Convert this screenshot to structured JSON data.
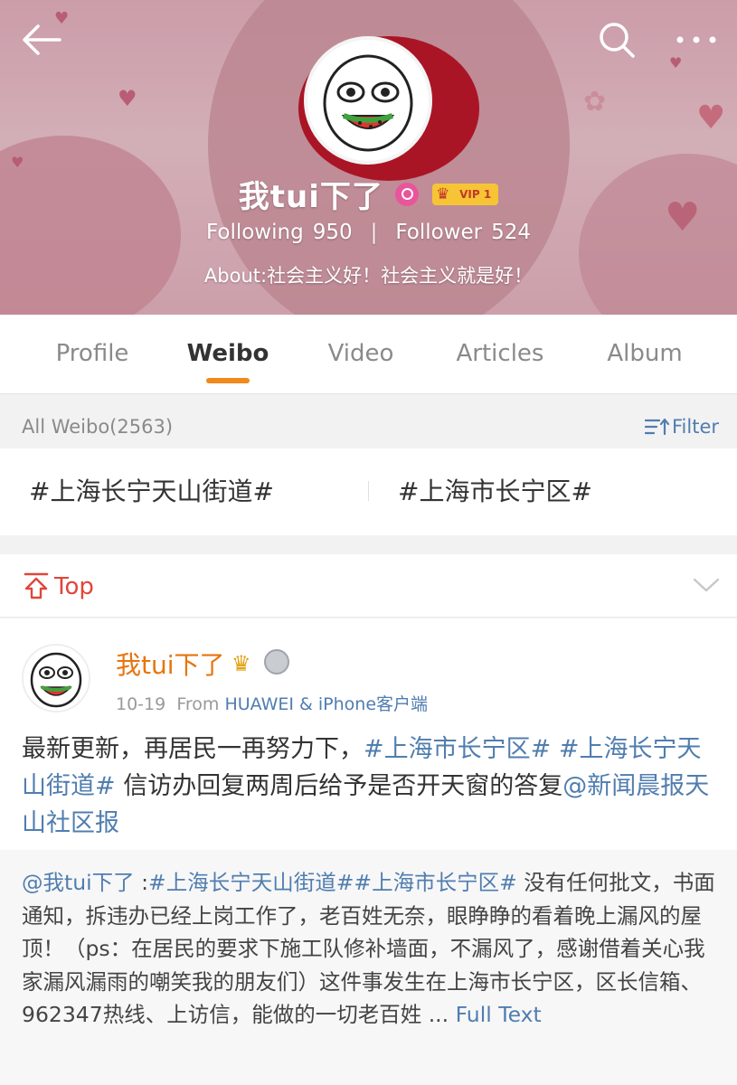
{
  "profile": {
    "name": "我tui下了",
    "vip_label": "VIP 1",
    "following_label": "Following",
    "following_count": "950",
    "follower_label": "Follower",
    "follower_count": "524",
    "separator": "|",
    "about": "About:社会主义好！社会主义就是好！"
  },
  "tabs": [
    {
      "label": "Profile"
    },
    {
      "label": "Weibo",
      "active": true
    },
    {
      "label": "Video"
    },
    {
      "label": "Articles"
    },
    {
      "label": "Album"
    }
  ],
  "feed_bar": {
    "all_label": "All Weibo(2563)",
    "filter_label": "Filter"
  },
  "topics": [
    "#上海长宁天山街道#",
    "#上海市长宁区#"
  ],
  "top_section": {
    "label": "Top"
  },
  "post": {
    "author": "我tui下了",
    "date": "10-19",
    "from_label": "From",
    "source": "HUAWEI & iPhone客户端",
    "text_1": "最新更新，再居民一再努力下，",
    "tag_1": "#上海市长宁区#",
    "tag_2": "#上海长宁天山街道#",
    "text_2": " 信访办回复两周后给予是否开天窗的答复",
    "mention": "@新闻晨报天山社区报",
    "repost": {
      "author_mention": "@我tui下了",
      "colon": " :",
      "tags": "#上海长宁天山街道##上海市长宁区#",
      "text": " 没有任何批文，书面通知，拆违办已经上岗工作了，老百姓无奈，眼睁睁的看着晚上漏风的屋顶！（ps：在居民的要求下施工队修补墙面，不漏风了，感谢借着关心我家漏风漏雨的嘲笑我的朋友们）这件事发生在上海市长宁区，区长信箱、962347热线、上访信，能做的一切老百姓",
      "ellipsis": " ... ",
      "full_text_label": "Full Text"
    }
  },
  "colors": {
    "accent_orange": "#f08a1c",
    "link_blue": "#507daf",
    "top_red": "#e0463a",
    "name_orange": "#e8740d"
  },
  "icons": [
    "back-arrow-icon",
    "search-icon",
    "more-icon",
    "filter-icon",
    "pin-top-icon",
    "chevron-down-icon",
    "crown-icon",
    "medal-icon"
  ]
}
